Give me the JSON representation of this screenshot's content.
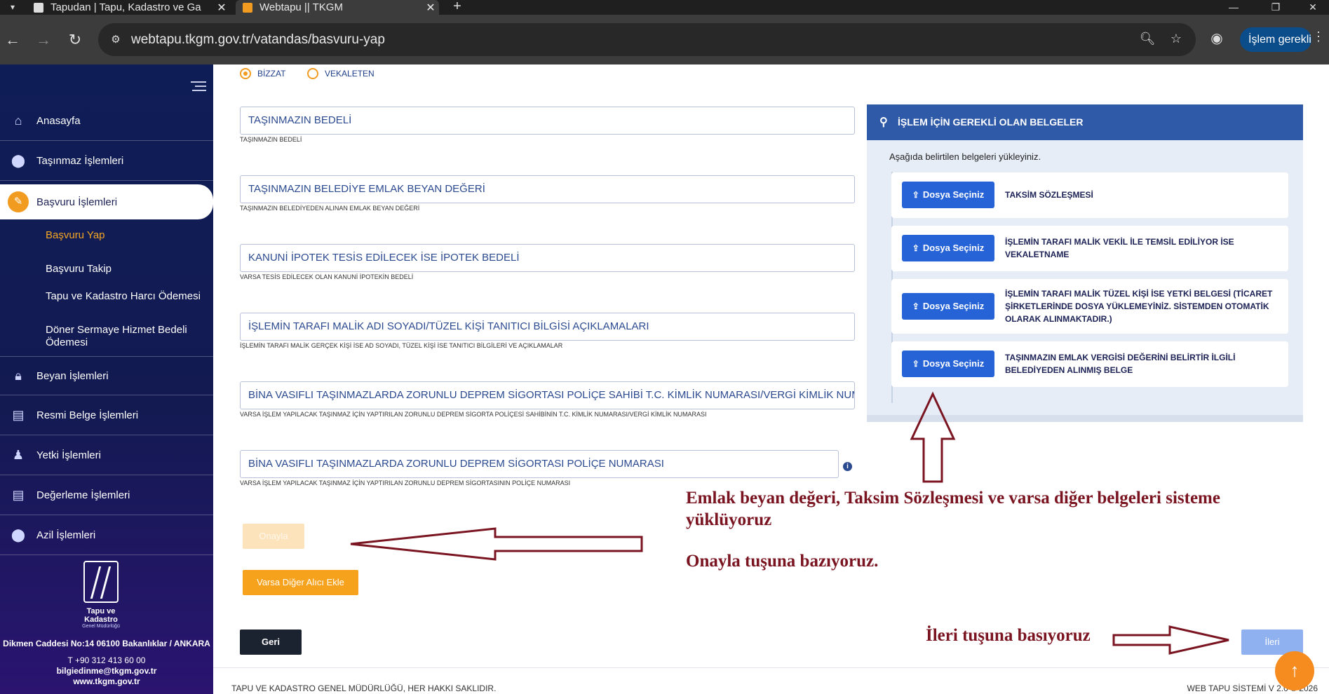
{
  "browser": {
    "tabs": [
      {
        "title": "Tapudan | Tapu, Kadastro ve Ga"
      },
      {
        "title": "Webtapu || TKGM"
      }
    ],
    "url": "webtapu.tkgm.gov.tr/vatandas/basvuru-yap",
    "action_pill": "İşlem gerekli"
  },
  "sidebar": {
    "items": [
      {
        "label": "Anasayfa",
        "icon": "home-icon"
      },
      {
        "label": "Taşınmaz İşlemleri",
        "icon": "map-pin-icon"
      },
      {
        "label": "Başvuru İşlemleri",
        "icon": "edit-icon"
      },
      {
        "label": "Beyan İşlemleri",
        "icon": "lock-icon"
      },
      {
        "label": "Resmi Belge İşlemleri",
        "icon": "document-icon"
      },
      {
        "label": "Yetki İşlemleri",
        "icon": "user-icon"
      },
      {
        "label": "Değerleme İşlemleri",
        "icon": "document-icon"
      },
      {
        "label": "Azil İşlemleri",
        "icon": "map-pin-icon"
      }
    ],
    "subitems": [
      {
        "label": "Başvuru Yap"
      },
      {
        "label": "Başvuru Takip"
      },
      {
        "label": "Tapu ve Kadastro Harcı Ödemesi"
      },
      {
        "label": "Döner Sermaye Hizmet Bedeli Ödemesi"
      }
    ],
    "logo": {
      "name": "Tapu ve Kadastro",
      "sub": "Genel Müdürlüğü"
    },
    "address": "Dikmen Caddesi No:14 06100 Bakanlıklar / ANKARA",
    "phone": "T +90 312 413 60 00",
    "email": "bilgiedinme@tkgm.gov.tr",
    "web": "www.tkgm.gov.tr"
  },
  "form": {
    "radios": [
      {
        "label": "BİZZAT",
        "selected": true
      },
      {
        "label": "VEKALETEN",
        "selected": false
      }
    ],
    "fields": [
      {
        "placeholder": "TAŞINMAZIN BEDELİ",
        "hint": "TAŞINMAZIN BEDELİ"
      },
      {
        "placeholder": "TAŞINMAZIN BELEDİYE EMLAK BEYAN DEĞERİ",
        "hint": "TAŞINMAZIN BELEDİYEDEN ALINAN EMLAK BEYAN DEĞERİ"
      },
      {
        "placeholder": "KANUNİ İPOTEK TESİS EDİLECEK İSE İPOTEK BEDELİ",
        "hint": "VARSA TESİS EDİLECEK OLAN KANUNİ İPOTEKİN BEDELİ"
      },
      {
        "placeholder": "İŞLEMİN TARAFI MALİK ADI SOYADI/TÜZEL KİŞİ TANITICI BİLGİSİ AÇIKLAMALARI",
        "hint": "İŞLEMİN TARAFI MALİK GERÇEK KİŞİ İSE AD SOYADI, TÜZEL KİŞİ İSE TANITICI BİLGİLERİ VE AÇIKLAMALAR"
      },
      {
        "placeholder": "BİNA VASIFLI TAŞINMAZLARDA ZORUNLU DEPREM SİGORTASI POLİÇE SAHİBİ T.C. KİMLİK NUMARASI/VERGİ KİMLİK NUMARASI",
        "hint": "VARSA İŞLEM YAPILACAK TAŞINMAZ İÇİN YAPTIRILAN ZORUNLU DEPREM SİGORTA POLİÇESİ SAHİBİNİN T.C. KİMLİK NUMARASI/VERGİ KİMLİK NUMARASI"
      },
      {
        "placeholder": "BİNA VASIFLI TAŞINMAZLARDA ZORUNLU DEPREM SİGORTASI POLİÇE NUMARASI",
        "hint": "VARSA İŞLEM YAPILACAK TAŞINMAZ İÇİN YAPTIRILAN ZORUNLU DEPREM SİGORTASININ POLİÇE NUMARASI"
      }
    ],
    "info_symbol": "i",
    "onayla_label": "Onayla",
    "varsa_label": "Varsa Diğer Alıcı Ekle",
    "geri_label": "Geri",
    "ileri_label": "İleri"
  },
  "documents": {
    "title": "İŞLEM İÇİN GEREKLİ OLAN BELGELER",
    "intro": "Aşağıda belirtilen belgeleri yükleyiniz.",
    "button_label": "Dosya Seçiniz",
    "items": [
      {
        "label": "TAKSİM SÖZLEŞMESİ"
      },
      {
        "label": "İŞLEMİN TARAFI MALİK VEKİL İLE TEMSİL EDİLİYOR İSE VEKALETNAME"
      },
      {
        "label": "İŞLEMİN TARAFI MALİK TÜZEL KİŞİ İSE YETKİ BELGESİ (TİCARET ŞİRKETLERİNDE DOSYA YÜKLEMEYİNİZ. SİSTEMDEN OTOMATİK OLARAK ALINMAKTADIR.)"
      },
      {
        "label": "TAŞINMAZIN EMLAK VERGİSİ DEĞERİNİ BELİRTİR İLGİLİ BELEDİYEDEN ALINMIŞ BELGE"
      }
    ]
  },
  "annotations": {
    "note1": "Emlak beyan değeri, Taksim Sözleşmesi ve varsa diğer belgeleri sisteme yüklüyoruz",
    "note2": "Onayla tuşuna bazıyoruz.",
    "note3": "İleri tuşuna basıyoruz",
    "color": "#7a1420"
  },
  "footer": {
    "left": "TAPU VE KADASTRO GENEL MÜDÜRLÜĞÜ, HER HAKKI SAKLIDIR.",
    "right": "WEB TAPU SİSTEMİ V 2.0 © 2026"
  },
  "colors": {
    "sidebar": "#131a52",
    "accent": "#f29b21",
    "panel_header": "#2f5aa8",
    "doc_button": "#2563d6"
  }
}
